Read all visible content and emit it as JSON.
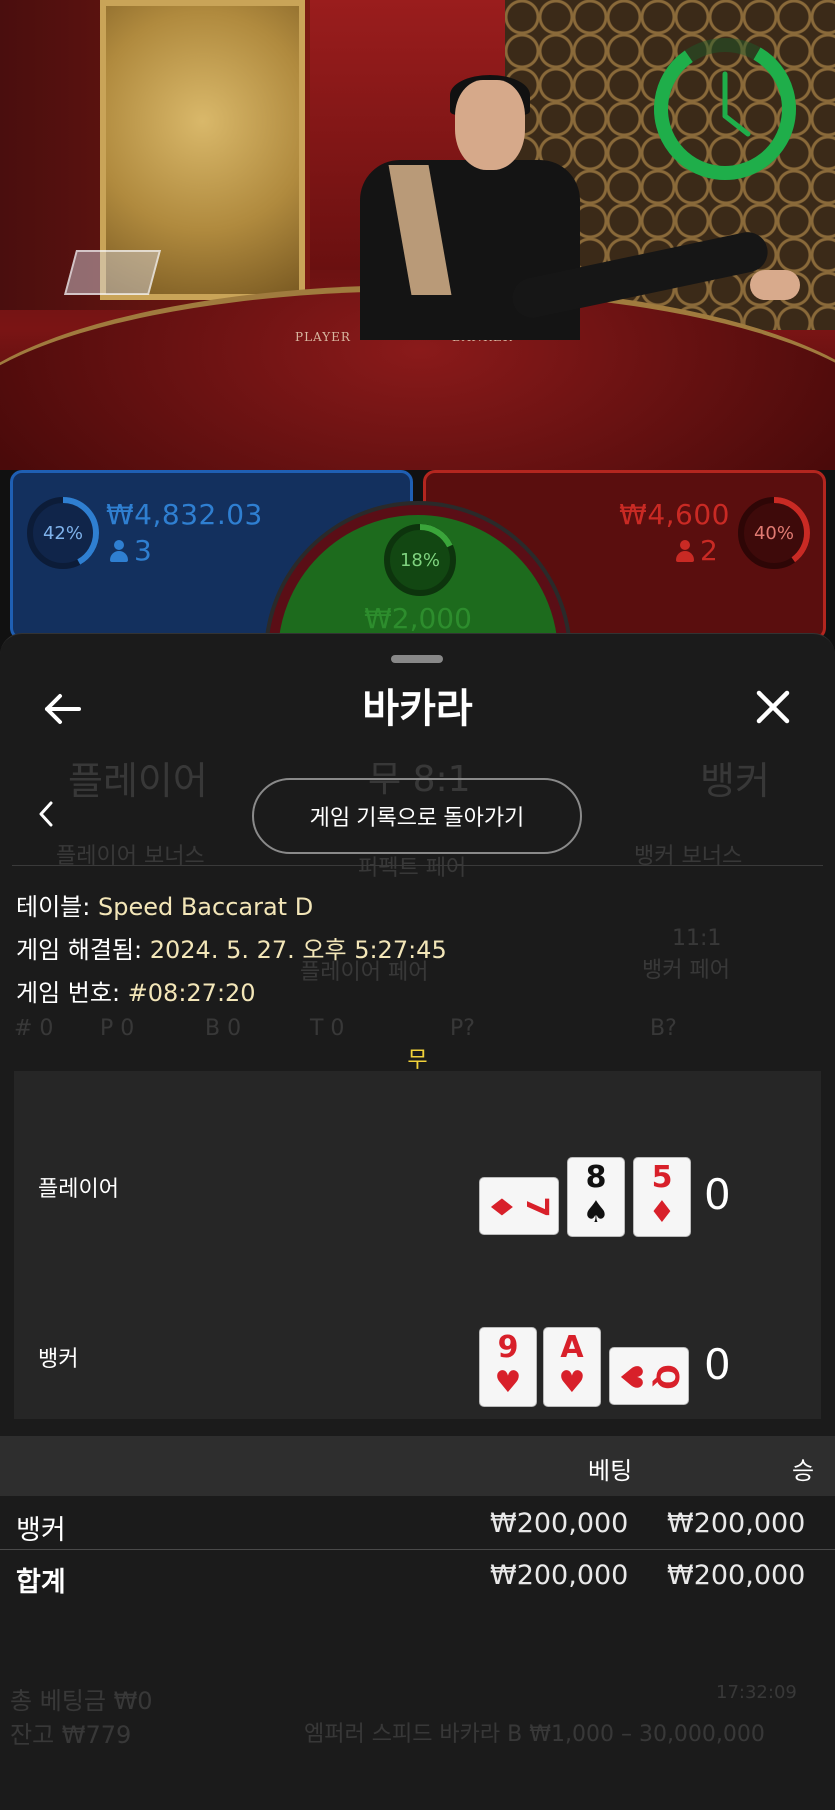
{
  "stats": {
    "player": {
      "percent": "42%",
      "percent_value": 0.42,
      "amount": "₩4,832.03",
      "count": "3",
      "color": "#2f7fd1"
    },
    "banker": {
      "percent": "40%",
      "percent_value": 0.4,
      "amount": "₩4,600",
      "count": "2",
      "color": "#c92a24"
    },
    "tie": {
      "percent": "18%",
      "percent_value": 0.18,
      "amount": "₩2,000",
      "color": "#3aa53a"
    }
  },
  "table_labels": {
    "player": "PLAYER",
    "banker": "BANKER"
  },
  "ghost": {
    "player": "플레이어",
    "tie": "무 8:1",
    "banker": "뱅커",
    "player_bonus": "플레이어 보너스",
    "perfect_pair": "퍼펙트 페어",
    "banker_bonus": "뱅커 보너스",
    "player_pair": "플레이어 페어",
    "banker_pair_odds": "11:1",
    "banker_pair": "뱅커 페어",
    "road": [
      "# 0",
      "P 0",
      "B 0",
      "T 0",
      "P?",
      "B?"
    ],
    "total_bet": "총 베팅금 ₩0",
    "balance": "잔고 ₩779",
    "time": "17:32:09",
    "table_limits": "엠퍼러 스피드 바카라 B  ₩1,000 – 30,000,000"
  },
  "sheet": {
    "title": "바카라",
    "back_to_history": "게임 기록으로 돌아가기",
    "info": {
      "table_label": "테이블: ",
      "table_value": "Speed Baccarat D",
      "resolved_label": "게임 해결됨: ",
      "resolved_value": "2024. 5. 27. 오후 5:27:45",
      "game_no_label": "게임 번호: ",
      "game_no_value": "#08:27:20"
    },
    "result": "무",
    "player": {
      "label": "플레이어",
      "score": "0",
      "cards": [
        {
          "rank": "7",
          "suit": "♦",
          "color": "red",
          "orientation": "sideways"
        },
        {
          "rank": "8",
          "suit": "♠",
          "color": "black",
          "orientation": "upright"
        },
        {
          "rank": "5",
          "suit": "♦",
          "color": "red",
          "orientation": "upright"
        }
      ]
    },
    "banker": {
      "label": "뱅커",
      "score": "0",
      "cards": [
        {
          "rank": "9",
          "suit": "♥",
          "color": "red",
          "orientation": "upright"
        },
        {
          "rank": "A",
          "suit": "♥",
          "color": "red",
          "orientation": "upright"
        },
        {
          "rank": "Q",
          "suit": "♥",
          "color": "red",
          "orientation": "sideways"
        }
      ]
    },
    "bets": {
      "col_bet": "베팅",
      "col_win": "승",
      "rows": [
        {
          "name": "뱅커",
          "bet": "₩200,000",
          "win": "₩200,000"
        },
        {
          "name": "합계",
          "bet": "₩200,000",
          "win": "₩200,000"
        }
      ]
    }
  }
}
